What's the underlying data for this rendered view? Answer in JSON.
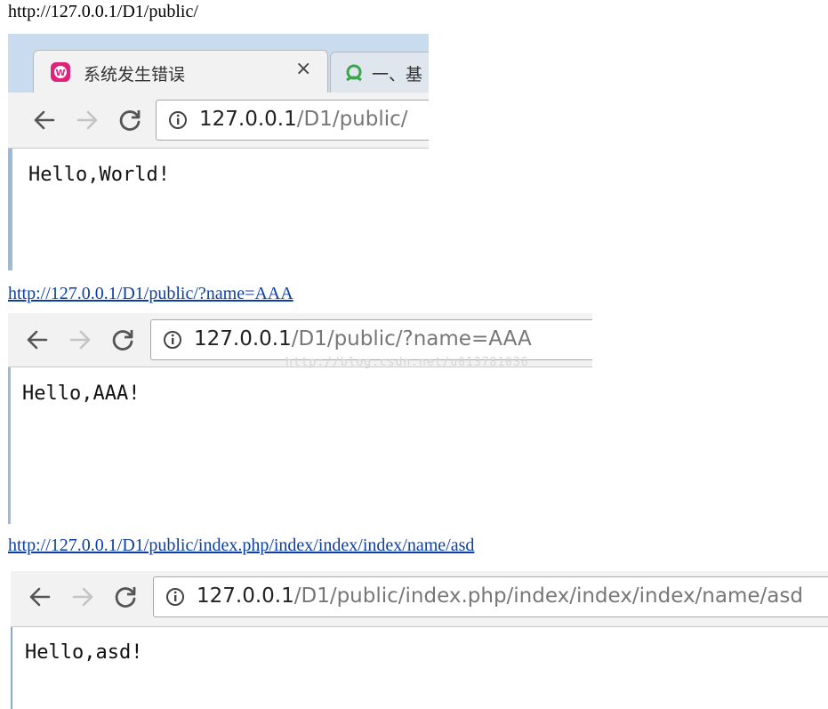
{
  "captions": [
    {
      "text": "http://127.0.0.1/D1/public/"
    },
    {
      "text": "http://127.0.0.1/D1/public/?name=AAA"
    },
    {
      "text": "http://127.0.0.1/D1/public/index.php/index/index/index/name/asd"
    }
  ],
  "shot1": {
    "tab_active_title": "系统发生错误",
    "tab_next_title": "一、基",
    "url_host": "127.0.0.1",
    "url_path": "/D1/public/",
    "page_text": "Hello,World!"
  },
  "shot2": {
    "url_host": "127.0.0.1",
    "url_path": "/D1/public/?name=AAA",
    "watermark": "http://blog.csdn.net/u013781036",
    "page_text": "Hello,AAA!"
  },
  "shot3": {
    "url_host": "127.0.0.1",
    "url_path": "/D1/public/index.php/index/index/index/name/asd",
    "page_text": "Hello,asd!"
  },
  "icons": {
    "back": "back-arrow-icon",
    "forward": "forward-arrow-icon",
    "reload": "reload-icon",
    "info": "info-icon",
    "close": "close-icon",
    "wamp": "wamp-favicon-icon",
    "next_tab": "site-favicon-icon"
  },
  "colors": {
    "link": "#0b3ea8",
    "favicon": "#e0227a",
    "tabstrip": "#c9dcef",
    "toolbar": "#f2f2f2"
  }
}
